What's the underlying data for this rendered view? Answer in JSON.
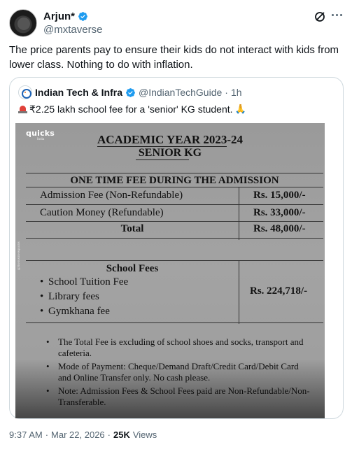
{
  "author": {
    "name": "Arjun*",
    "handle": "@mxtaverse"
  },
  "tweet": {
    "text": "The price parents pay to ensure their kids do not interact with kids from lower class. Nothing to do with inflation."
  },
  "quote": {
    "name": "Indian Tech & Infra",
    "handle": "@IndianTechGuide",
    "separator": "·",
    "time": "1h",
    "text": "₹2.25 lakh school fee for a 'senior' KG student."
  },
  "media": {
    "brand": "quicks",
    "brand_sub": "India",
    "watermark": "@thebusinessquicks",
    "academic_year": "ACADEMIC YEAR 2023-24",
    "grade": "SENIOR KG",
    "one_time_title": "ONE TIME FEE DURING THE ADMISSION",
    "fees": [
      {
        "label": "Admission Fee (Non-Refundable)",
        "amount": "Rs. 15,000/-"
      },
      {
        "label": "Caution Money (Refundable)",
        "amount": "Rs. 33,000/-"
      }
    ],
    "total": {
      "label": "Total",
      "amount": "Rs. 48,000/-"
    },
    "school_fees": {
      "title": "School Fees",
      "items": [
        "School Tuition Fee",
        "Library fees",
        "Gymkhana fee"
      ],
      "amount": "Rs. 224,718/-"
    },
    "notes": [
      "The Total Fee is excluding of school shoes and socks, transport and cafeteria.",
      "Mode of Payment: Cheque/Demand Draft/Credit Card/Debit Card and Online Transfer only. No cash please.",
      "Note: Admission Fees & School Fees paid are Non-Refundable/Non-Transferable."
    ]
  },
  "meta": {
    "time": "9:37 AM",
    "dot1": "·",
    "date": "Mar 22, 2026",
    "dot2": "·",
    "views": "25K",
    "views_label": "Views"
  },
  "colors": {
    "accent": "#1d9bf0",
    "text": "#0f1419",
    "muted": "#536471",
    "border": "#cfd9de"
  }
}
